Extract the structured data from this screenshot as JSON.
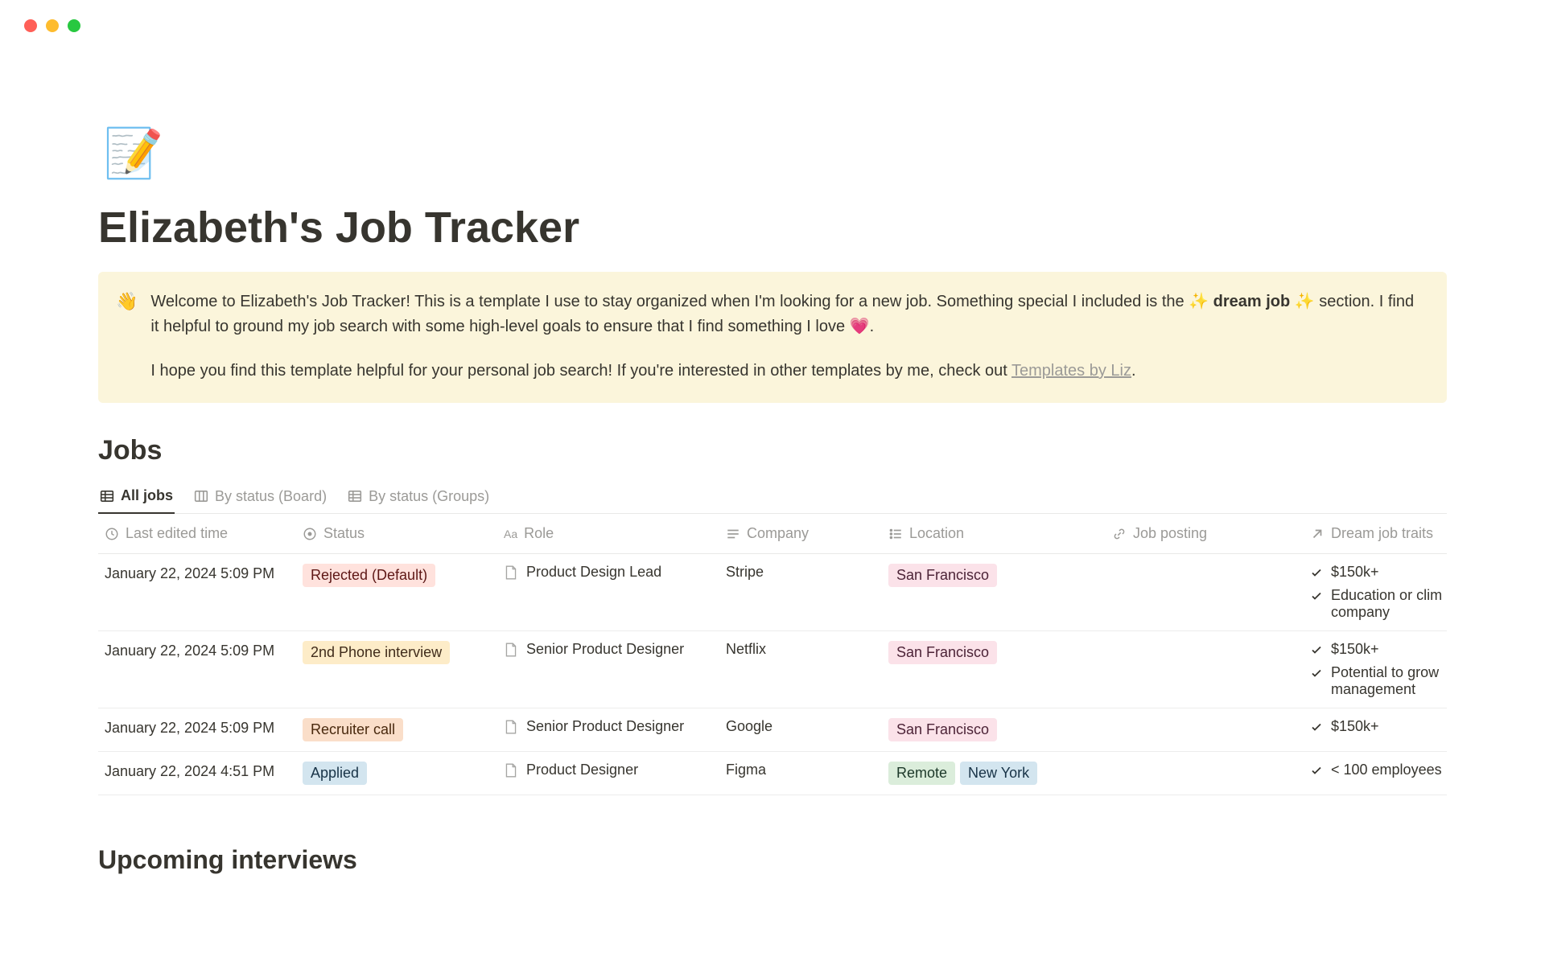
{
  "page": {
    "icon": "📝",
    "title": "Elizabeth's Job Tracker"
  },
  "callout": {
    "icon": "👋",
    "text_a": "Welcome to Elizabeth's Job Tracker! This is a template I use to stay organized when I'm looking for a new job. Something special I included is the ",
    "sparkle": "✨",
    "bold": "dream job",
    "text_b": " section. I find it helpful to ground my job search with some high-level goals to ensure that I find something I love ",
    "heart": "💗",
    "period": ".",
    "text_c": "I hope you find this template helpful for your personal job search! If you're interested in other templates by me, check out ",
    "link": "Templates by Liz",
    "period2": "."
  },
  "sections": {
    "jobs": "Jobs",
    "upcoming": "Upcoming interviews"
  },
  "tabs": [
    {
      "label": "All jobs",
      "active": true,
      "icon": "table"
    },
    {
      "label": "By status (Board)",
      "active": false,
      "icon": "board"
    },
    {
      "label": "By status (Groups)",
      "active": false,
      "icon": "table"
    }
  ],
  "columns": {
    "time": "Last edited time",
    "status": "Status",
    "role": "Role",
    "company": "Company",
    "location": "Location",
    "posting": "Job posting",
    "traits": "Dream job traits"
  },
  "rows": [
    {
      "time": "January 22, 2024 5:09 PM",
      "status": {
        "label": "Rejected (Default)",
        "color": "red"
      },
      "role": "Product Design Lead",
      "company": "Stripe",
      "locations": [
        {
          "label": "San Francisco",
          "color": "pink"
        }
      ],
      "traits": [
        "$150k+",
        "Education or clim company"
      ]
    },
    {
      "time": "January 22, 2024 5:09 PM",
      "status": {
        "label": "2nd Phone interview",
        "color": "yellow"
      },
      "role": "Senior Product Designer",
      "company": "Netflix",
      "locations": [
        {
          "label": "San Francisco",
          "color": "pink"
        }
      ],
      "traits": [
        "$150k+",
        "Potential to grow management"
      ]
    },
    {
      "time": "January 22, 2024 5:09 PM",
      "status": {
        "label": "Recruiter call",
        "color": "orange"
      },
      "role": "Senior Product Designer",
      "company": "Google",
      "locations": [
        {
          "label": "San Francisco",
          "color": "pink"
        }
      ],
      "traits": [
        "$150k+"
      ]
    },
    {
      "time": "January 22, 2024 4:51 PM",
      "status": {
        "label": "Applied",
        "color": "blue"
      },
      "role": "Product Designer",
      "company": "Figma",
      "locations": [
        {
          "label": "Remote",
          "color": "green"
        },
        {
          "label": "New York",
          "color": "blue"
        }
      ],
      "traits": [
        "< 100 employees"
      ]
    }
  ]
}
